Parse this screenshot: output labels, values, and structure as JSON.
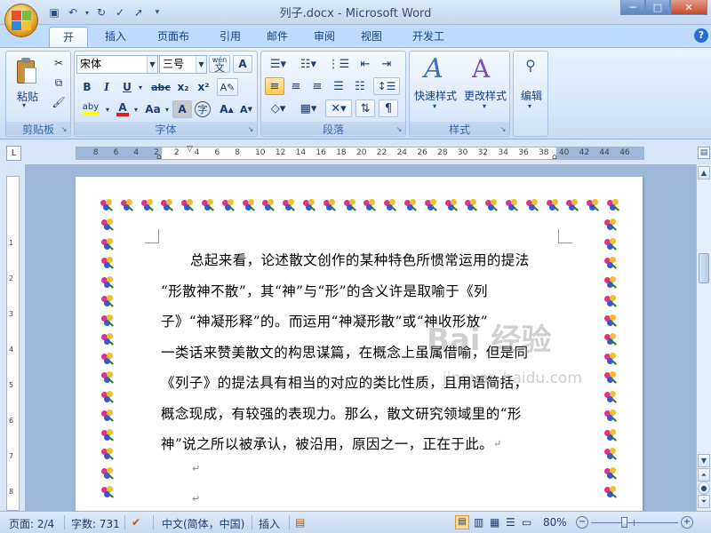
{
  "window": {
    "title": "列子.docx - Microsoft Word",
    "controls": {
      "minimize": "─",
      "maximize": "□",
      "close": "✕"
    }
  },
  "quick_access": {
    "icons": [
      "save-icon",
      "undo-icon",
      "redo-icon",
      "check-icon",
      "pointer-icon",
      "customize-icon"
    ]
  },
  "ribbon": {
    "tabs": [
      "开始",
      "插入",
      "页面布局",
      "引用",
      "邮件",
      "审阅",
      "视图",
      "开发工具"
    ],
    "active_tab": "开始",
    "groups": {
      "clipboard": {
        "label": "剪贴板",
        "paste_label": "粘贴"
      },
      "font": {
        "label": "字体",
        "font_name": "宋体",
        "font_size": "三号",
        "wen_label": "wén",
        "bold": "B",
        "italic": "I",
        "underline": "U",
        "strike": "abc",
        "subscript": "x₂",
        "superscript": "x²",
        "highlight": "aby",
        "font_color": "A",
        "change_case": "Aa",
        "char_shading": "A",
        "enclose": "字",
        "grow": "A",
        "shrink": "A"
      },
      "paragraph": {
        "label": "段落"
      },
      "styles": {
        "label": "样式",
        "quick_styles": "快速样式",
        "change_styles": "更改样式"
      },
      "editing": {
        "label": "编辑"
      }
    },
    "help": "?"
  },
  "ruler": {
    "h_ticks": [
      "8",
      "6",
      "4",
      "2",
      "2",
      "4",
      "6",
      "8",
      "10",
      "12",
      "14",
      "16",
      "18",
      "20",
      "22",
      "24",
      "26",
      "28",
      "30",
      "32",
      "34",
      "36",
      "38",
      "40",
      "42",
      "44",
      "46"
    ],
    "v_ticks": [
      "1",
      "2",
      "3",
      "4",
      "5",
      "6",
      "7",
      "8"
    ]
  },
  "document": {
    "lines": [
      "总起来看，论述散文创作的某种特色所惯常运用的提法",
      "“形散神不散”，其“神”与“形”的含义许是取喻于《列",
      "子》“神凝形释”的。而运用“神凝形散”或“神收形放”",
      "一类话来赞美散文的构思谋篇，在概念上虽属借喻，但是同",
      "《列子》的提法具有相当的对应的类比性质，且用语简括，",
      "概念现成，有较强的表现力。那么，散文研究领域里的“形",
      "神”说之所以被承认，被沿用，原因之一，正在于此。"
    ],
    "para_mark": "↵"
  },
  "watermark": {
    "main": "Bai  经验",
    "sub": "jingyan.baidu.com"
  },
  "statusbar": {
    "page": "页面: 2/4",
    "words": "字数: 731",
    "language": "中文(简体，中国)",
    "mode": "插入",
    "zoom": "80%",
    "zoom_level": 0.8
  },
  "colors": {
    "accent": "#15428b",
    "ribbon_bg": "#dbe8f8",
    "page_bg": "#9fb7d9"
  }
}
